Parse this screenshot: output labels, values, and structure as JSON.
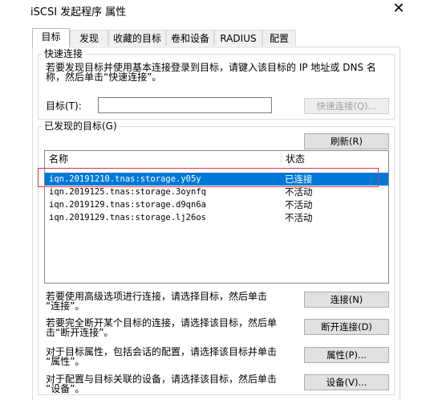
{
  "window": {
    "title": "iSCSI 发起程序 属性",
    "close_glyph": "✕"
  },
  "tabs": [
    {
      "label": "目标",
      "active": true
    },
    {
      "label": "发现",
      "active": false
    },
    {
      "label": "收藏的目标",
      "active": false
    },
    {
      "label": "卷和设备",
      "active": false
    },
    {
      "label": "RADIUS",
      "active": false
    },
    {
      "label": "配置",
      "active": false
    }
  ],
  "quick_connect": {
    "group_title": "快速连接",
    "description_line1": "若要发现目标并使用基本连接登录到目标，请键入该目标的 IP 地址或 DNS 名",
    "description_line2": "称，然后单击“快速连接”。",
    "target_label": "目标(T):",
    "target_value": "",
    "button_label": "快速连接(Q)..."
  },
  "discovered": {
    "group_title": "已发现的目标(G)",
    "refresh_label": "刷新(R)",
    "columns": [
      "名称",
      "状态"
    ],
    "rows": [
      {
        "name": "iqn.20191210.tnas:storage.y05y",
        "status": "已连接",
        "selected": true
      },
      {
        "name": "iqn.2019125.tnas:storage.3oynfq",
        "status": "不活动",
        "selected": false
      },
      {
        "name": "iqn.2019129.tnas:storage.d9qn6a",
        "status": "不活动",
        "selected": false
      },
      {
        "name": "iqn.2019129.tnas:storage.lj26os",
        "status": "不活动",
        "selected": false
      }
    ]
  },
  "actions": [
    {
      "text_line1": "若要使用高级选项进行连接，请选择目标，然后单击",
      "text_line2": "“连接”。",
      "button": "连接(N)"
    },
    {
      "text_line1": "若要完全断开某个目标的连接，请选择该目标，然后单",
      "text_line2": "击“断开连接”。",
      "button": "断开连接(D)"
    },
    {
      "text_line1": "对于目标属性，包括会话的配置，请选择该目标并单击",
      "text_line2": "“属性”。",
      "button": "属性(P)..."
    },
    {
      "text_line1": "对于配置与目标关联的设备，请选择该目标，然后单击",
      "text_line2": "“设备”。",
      "button": "设备(V)..."
    }
  ],
  "colors": {
    "selection": "#0078d7",
    "annotation_box": "#e0353c"
  }
}
